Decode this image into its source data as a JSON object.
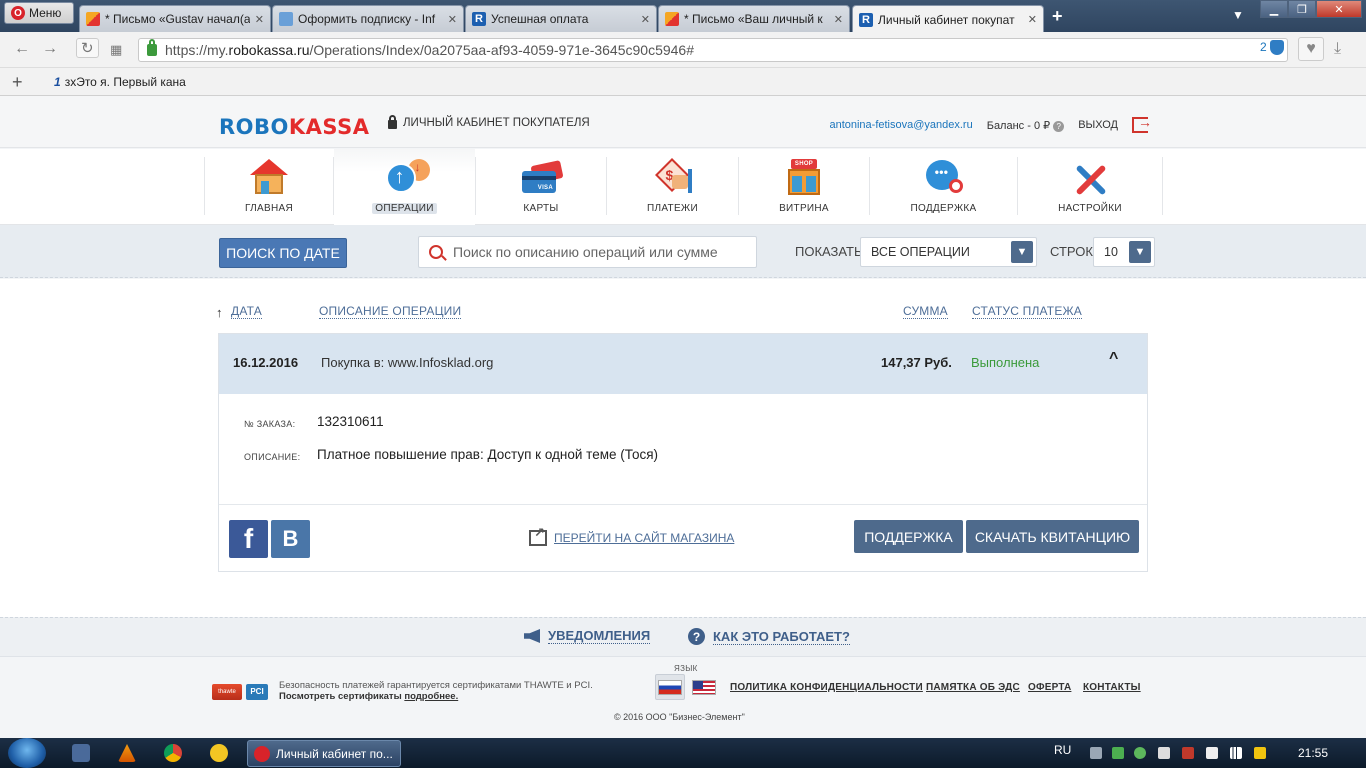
{
  "browser": {
    "menu_label": "Меню",
    "tabs": [
      {
        "title": "* Письмо «Gustav начал(а)",
        "icon": "mail"
      },
      {
        "title": "Оформить подписку - Inf",
        "icon": "image"
      },
      {
        "title": "Успешная оплата",
        "icon": "robokassa"
      },
      {
        "title": "* Письмо «Ваш личный к",
        "icon": "mail"
      },
      {
        "title": "Личный кабинет покупат",
        "icon": "robokassa"
      }
    ],
    "new_tab": "+",
    "url_prefix": "https://my.",
    "url_domain": "robokassa.ru",
    "url_path": "/Operations/Index/0a2075aa-af93-4059-971e-3645c90c5946#",
    "extension_badge": "2",
    "bookmark_add": "+",
    "bookmark_label": "зхЭто я. Первый кана",
    "bookmark_icon_text": "1"
  },
  "header": {
    "logo_blue": "ROBO",
    "logo_red": "KASSA",
    "cabinet_label": "ЛИЧНЫЙ КАБИНЕТ ПОКУПАТЕЛЯ",
    "email": "antonina-fetisova@yandex.ru",
    "balance": "Баланс - 0 ₽",
    "balance_icon": "?",
    "logout": "ВЫХОД"
  },
  "nav": {
    "items": [
      {
        "label": "ГЛАВНАЯ",
        "icon": "house-icon"
      },
      {
        "label": "ОПЕРАЦИИ",
        "icon": "operations-icon"
      },
      {
        "label": "КАРТЫ",
        "icon": "cards-icon"
      },
      {
        "label": "ПЛАТЕЖИ",
        "icon": "payments-icon"
      },
      {
        "label": "ВИТРИНА",
        "icon": "shop-icon"
      },
      {
        "label": "ПОДДЕРЖКА",
        "icon": "support-icon"
      },
      {
        "label": "НАСТРОЙКИ",
        "icon": "settings-icon"
      }
    ],
    "active": "ОПЕРАЦИИ",
    "shop_sign": "SHOP",
    "payment_symbol": "$",
    "chat_dots": "•••"
  },
  "filters": {
    "date_button": "ПОИСК ПО ДАТЕ",
    "search_placeholder": "Поиск по описанию операций или сумме",
    "show_label": "ПОКАЗАТЬ",
    "show_value": "ВСЕ ОПЕРАЦИИ",
    "rows_label": "СТРОК",
    "rows_value": "10",
    "dropdown_arrow": "▼"
  },
  "table": {
    "sort_arrow": "↑",
    "headers": {
      "date": "ДАТА",
      "description": "ОПИСАНИЕ ОПЕРАЦИИ",
      "sum": "СУММА",
      "status": "СТАТУС ПЛАТЕЖА"
    },
    "operation": {
      "date": "16.12.2016",
      "description": "Покупка в: www.Infosklad.org",
      "sum": "147,37 Руб.",
      "status": "Выполнена",
      "toggle": "^",
      "order_label": "№ ЗАКАЗА:",
      "order_value": "132310611",
      "desc_label": "ОПИСАНИЕ:",
      "desc_value": "Платное повышение прав: Доступ к одной теме (Тося)",
      "facebook": "f",
      "vk": "В",
      "shop_link": "ПЕРЕЙТИ НА САЙТ МАГАЗИНА",
      "support_button": "ПОДДЕРЖКА",
      "receipt_button": "СКАЧАТЬ КВИТАНЦИЮ"
    }
  },
  "notif_bar": {
    "notifications": "УВЕДОМЛЕНИЯ",
    "how_it_works": "КАК ЭТО РАБОТАЕТ?",
    "help_icon": "?"
  },
  "footer": {
    "thawte_badge": "thawte",
    "pci_badge": "PCI",
    "security_line1": "Безопасность платежей гарантируется сертификатами THAWTE и PCI.",
    "security_line2": "Посмотреть сертификаты",
    "security_link": "подробнее.",
    "lang_label": "ЯЗЫК",
    "links": [
      "ПОЛИТИКА КОНФИДЕНЦИАЛЬНОСТИ",
      "ПАМЯТКА ОБ ЭДС",
      "ОФЕРТА",
      "КОНТАКТЫ"
    ],
    "copyright": "© 2016 ООО \"Бизнес-Элемент\""
  },
  "taskbar": {
    "active_app": "Личный кабинет по...",
    "lang": "RU",
    "clock": "21:55"
  },
  "colors": {
    "brand_blue": "#1b75bc",
    "brand_red": "#e32b2b",
    "button_blue": "#4e6a8c",
    "status_green": "#3a9a3a",
    "link_blue": "#4e6e98"
  }
}
